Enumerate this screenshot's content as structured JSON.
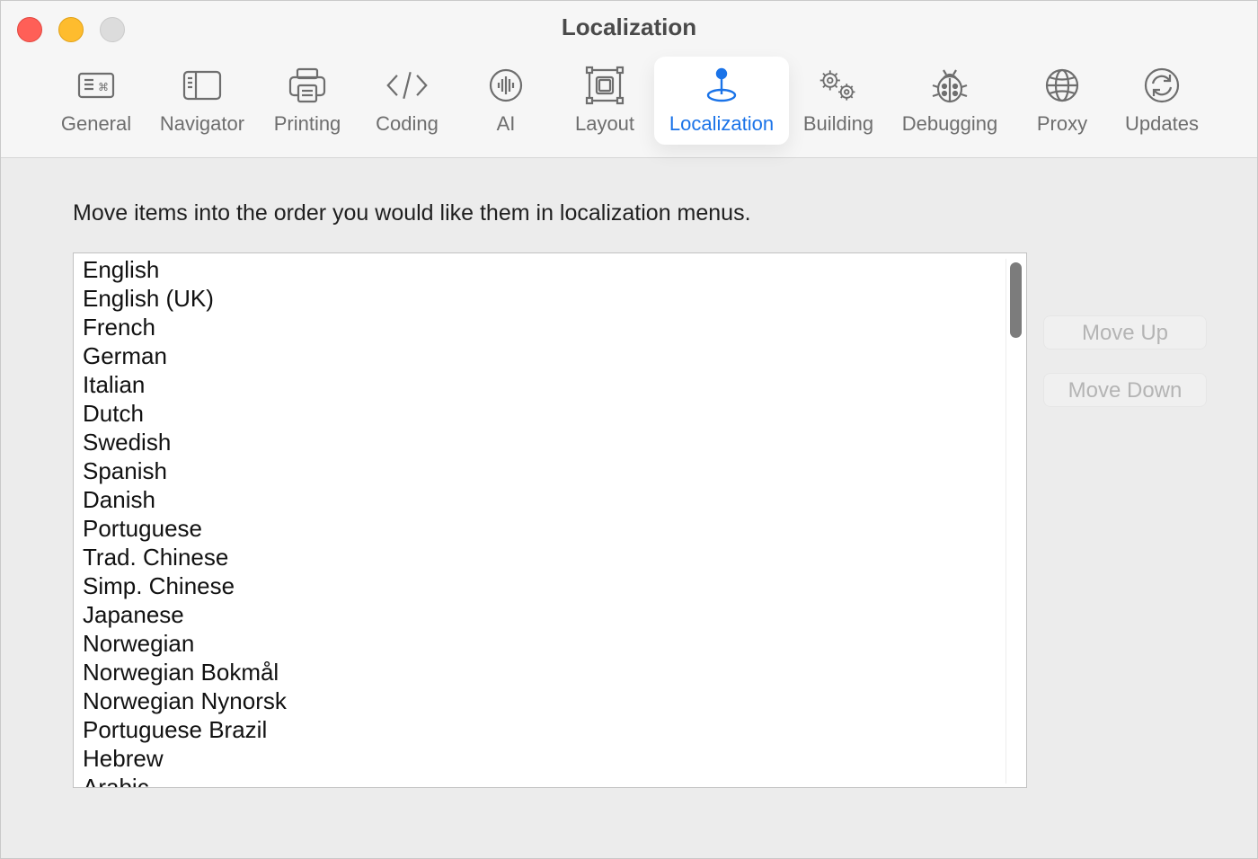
{
  "window": {
    "title": "Localization"
  },
  "toolbar": {
    "items": [
      {
        "label": "General",
        "icon": "keyboard-icon"
      },
      {
        "label": "Navigator",
        "icon": "sidebar-icon"
      },
      {
        "label": "Printing",
        "icon": "printer-icon"
      },
      {
        "label": "Coding",
        "icon": "code-brackets-icon"
      },
      {
        "label": "AI",
        "icon": "waveform-icon"
      },
      {
        "label": "Layout",
        "icon": "layout-frame-icon"
      },
      {
        "label": "Localization",
        "icon": "map-pin-icon",
        "active": true
      },
      {
        "label": "Building",
        "icon": "gears-icon"
      },
      {
        "label": "Debugging",
        "icon": "ladybug-icon"
      },
      {
        "label": "Proxy",
        "icon": "globe-icon"
      },
      {
        "label": "Updates",
        "icon": "refresh-icon"
      }
    ],
    "active_color": "#1a73e8"
  },
  "main": {
    "instructions": "Move items into the order you would like them in localization menus.",
    "languages": [
      "English",
      "English (UK)",
      "French",
      "German",
      "Italian",
      "Dutch",
      "Swedish",
      "Spanish",
      "Danish",
      "Portuguese",
      "Trad. Chinese",
      "Simp. Chinese",
      "Japanese",
      "Norwegian",
      "Norwegian Bokmål",
      "Norwegian Nynorsk",
      "Portuguese Brazil",
      "Hebrew",
      "Arabic"
    ],
    "move_up_label": "Move Up",
    "move_down_label": "Move Down"
  }
}
